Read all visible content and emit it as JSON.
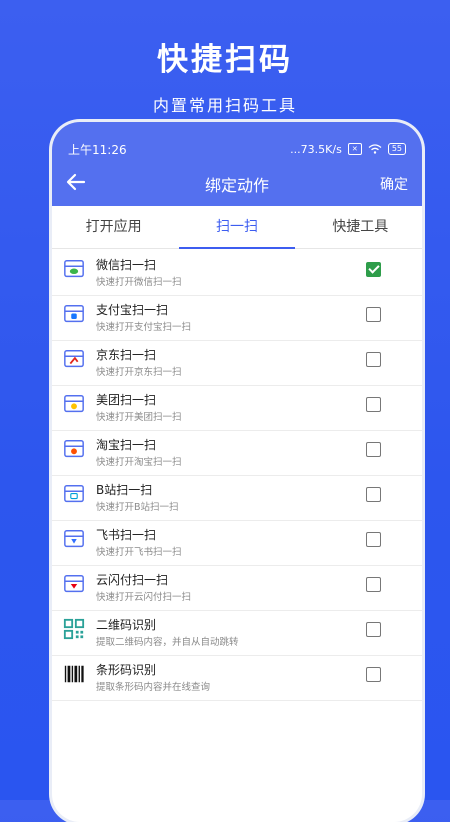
{
  "promo": {
    "title": "快捷扫码",
    "subtitle": "内置常用扫码工具"
  },
  "status_bar": {
    "time": "上午11:26",
    "speed": "...73.5K/s",
    "battery": "55"
  },
  "appbar": {
    "back_icon": "back-arrow-icon",
    "title": "绑定动作",
    "confirm_label": "确定",
    "color": "#5470ef"
  },
  "tabs": [
    {
      "label": "打开应用",
      "active": false
    },
    {
      "label": "扫一扫",
      "active": true
    },
    {
      "label": "快捷工具",
      "active": false
    }
  ],
  "items": [
    {
      "name": "微信扫一扫",
      "desc": "快速打开微信扫一扫",
      "icon": "wechat-scan-icon",
      "checked": true
    },
    {
      "name": "支付宝扫一扫",
      "desc": "快速打开支付宝扫一扫",
      "icon": "alipay-scan-icon",
      "checked": false
    },
    {
      "name": "京东扫一扫",
      "desc": "快速打开京东扫一扫",
      "icon": "jd-scan-icon",
      "checked": false
    },
    {
      "name": "美团扫一扫",
      "desc": "快速打开美团扫一扫",
      "icon": "meituan-scan-icon",
      "checked": false
    },
    {
      "name": "淘宝扫一扫",
      "desc": "快速打开淘宝扫一扫",
      "icon": "taobao-scan-icon",
      "checked": false
    },
    {
      "name": "B站扫一扫",
      "desc": "快速打开B站扫一扫",
      "icon": "bilibili-scan-icon",
      "checked": false
    },
    {
      "name": "飞书扫一扫",
      "desc": "快速打开飞书扫一扫",
      "icon": "feishu-scan-icon",
      "checked": false
    },
    {
      "name": "云闪付扫一扫",
      "desc": "快速打开云闪付扫一扫",
      "icon": "unionpay-scan-icon",
      "checked": false
    },
    {
      "name": "二维码识别",
      "desc": "提取二维码内容，并自从自动跳转",
      "icon": "qr-code-icon",
      "checked": false
    },
    {
      "name": "条形码识别",
      "desc": "提取条形码内容并在线查询",
      "icon": "barcode-icon",
      "checked": false
    }
  ],
  "colors": {
    "background": "#2d56ee",
    "accent": "#3d5df0",
    "checked": "#2e9d4a"
  }
}
